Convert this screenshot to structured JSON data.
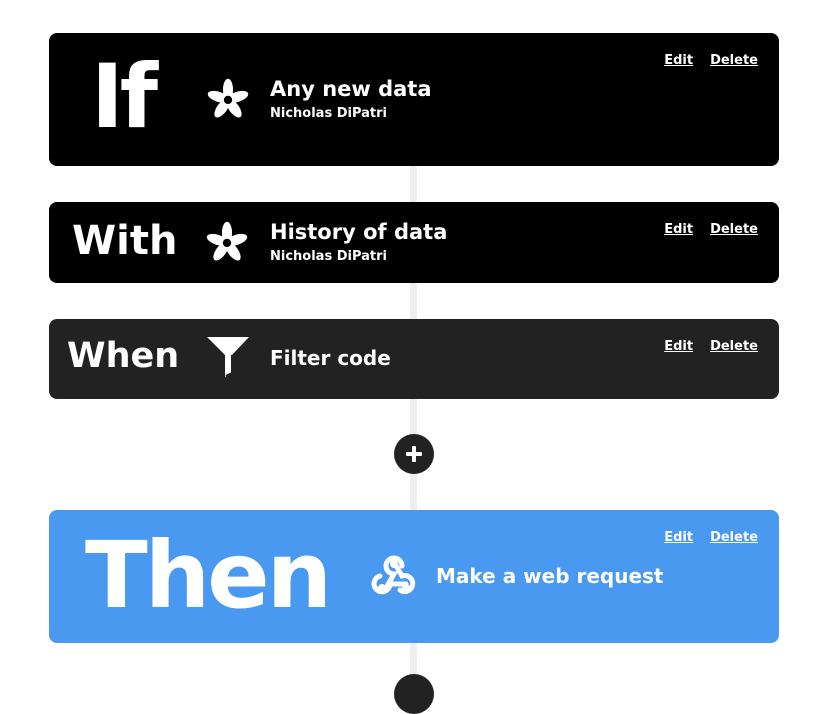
{
  "colors": {
    "trigger_bg": "#000000",
    "filter_bg": "#222222",
    "action_bg": "#4a99f0",
    "connector": "#eeeeee",
    "text": "#ffffff"
  },
  "if_block": {
    "keyword": "If",
    "service_icon": "adafruit-star-icon",
    "title": "Any new data",
    "subtitle": "Nicholas DiPatri",
    "edit_label": "Edit",
    "delete_label": "Delete"
  },
  "with_block": {
    "keyword": "With",
    "service_icon": "adafruit-star-icon",
    "title": "History of data",
    "subtitle": "Nicholas DiPatri",
    "edit_label": "Edit",
    "delete_label": "Delete"
  },
  "when_block": {
    "keyword": "When",
    "service_icon": "filter-icon",
    "title": "Filter code",
    "edit_label": "Edit",
    "delete_label": "Delete"
  },
  "add_step": {
    "icon": "plus-icon"
  },
  "then_block": {
    "keyword": "Then",
    "service_icon": "webhooks-icon",
    "title": "Make a web request",
    "edit_label": "Edit",
    "delete_label": "Delete"
  }
}
